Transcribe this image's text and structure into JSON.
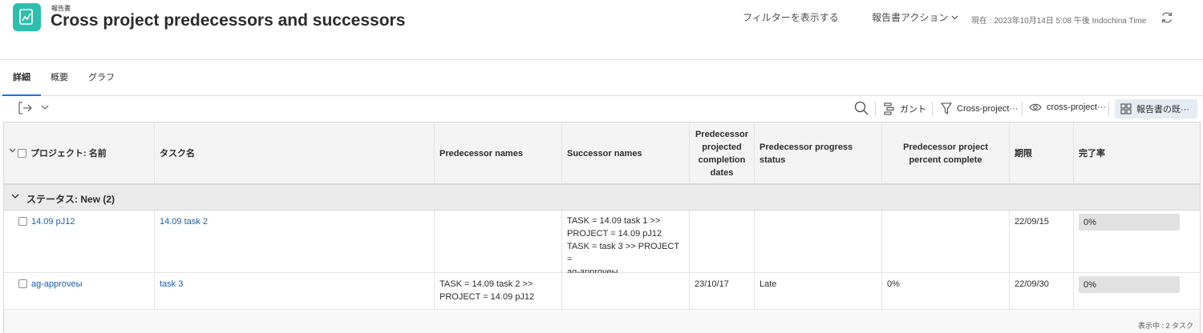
{
  "header": {
    "eyebrow": "報告書",
    "title": "Cross project predecessors and successors",
    "show_filters": "フィルターを表示する",
    "report_actions": "報告書アクション",
    "now": "現在 : 2023年10月14日 5:08 午後 Indochina Time"
  },
  "tabs": [
    {
      "label": "詳細",
      "active": true
    },
    {
      "label": "概要",
      "active": false
    },
    {
      "label": "グラフ",
      "active": false
    }
  ],
  "toolbar": {
    "gantt": "ガント",
    "filter": "Cross-project···",
    "view": "cross-project···",
    "grouping": "報告書の既···"
  },
  "columns": [
    "プロジェクト: 名前",
    "タスク名",
    "Predecessor names",
    "Successor names",
    "Predecessor projected completion dates",
    "Predecessor progress status",
    "Predecessor project percent complete",
    "期限",
    "完了率"
  ],
  "group": {
    "label": "ステータス: New (2)"
  },
  "rows": [
    {
      "project": "14.09 pJ12",
      "task": "14.09 task 2",
      "pred_names": "",
      "succ_names": [
        "TASK = 14.09 task 1 >>",
        "PROJECT = 14.09 pJ12",
        "TASK = task 3 >> PROJECT =",
        "ag-approveы"
      ],
      "pred_date": "",
      "pred_status": "",
      "pred_percent": "",
      "due": "22/09/15",
      "complete": "0%"
    },
    {
      "project": "ag-approveы",
      "task": "task 3",
      "pred_names": [
        "TASK = 14.09 task 2 >>",
        "PROJECT = 14.09 pJ12"
      ],
      "succ_names": "",
      "pred_date": "23/10/17",
      "pred_status": "Late",
      "pred_percent": "0%",
      "due": "22/09/30",
      "complete": "0%"
    }
  ],
  "footer": {
    "count": "表示中 : 2 タスク"
  },
  "colors": {
    "accent": "#1473e6",
    "app_icon": "#2dbfae",
    "link": "#1a5fa8"
  }
}
